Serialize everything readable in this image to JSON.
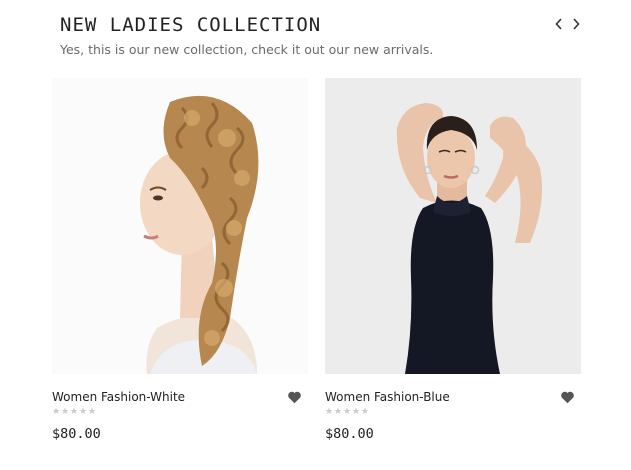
{
  "section": {
    "title": "NEW LADIES COLLECTION",
    "subtitle": "Yes, this is our new collection, check it out our new arrivals."
  },
  "nav": {
    "prev_icon": "chevron-left-icon",
    "next_icon": "chevron-right-icon"
  },
  "products": [
    {
      "name": "Women Fashion-White",
      "price": "$80.00",
      "rating": 0,
      "image": "woman-curly-blonde-hair-photo"
    },
    {
      "name": "Women Fashion-Blue",
      "price": "$80.00",
      "rating": 0,
      "image": "woman-black-dress-photo"
    }
  ],
  "colors": {
    "text": "#222222",
    "muted": "#6a6a6a",
    "heart": "#555555",
    "star": "#cccccc"
  }
}
